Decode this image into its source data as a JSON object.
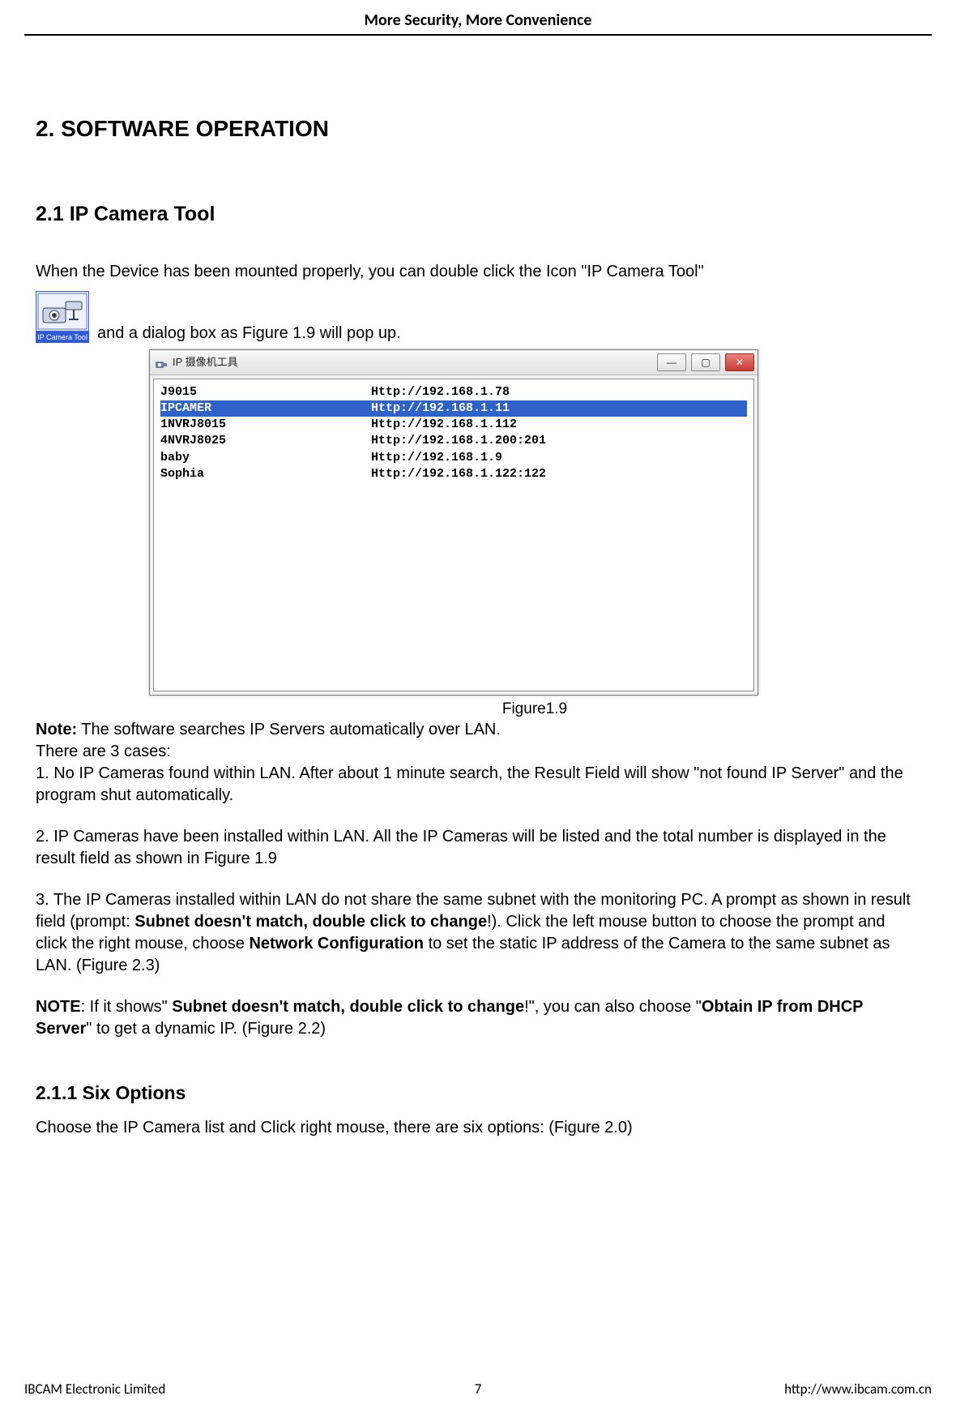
{
  "header": {
    "title": "More Security, More Convenience"
  },
  "section": {
    "h1": "2. SOFTWARE OPERATION",
    "h2": "2.1 IP Camera Tool"
  },
  "intro": {
    "line1": "When the Device has been mounted properly, you can double click the Icon \"IP Camera Tool\"",
    "iconLabel": "IP Camera Tool",
    "line2": " and a dialog box as Figure 1.9 will pop up."
  },
  "window": {
    "title": "IP 摄像机工具",
    "btnMin": "—",
    "btnMax": "▢",
    "btnClose": "✕",
    "rows": [
      {
        "name": "J9015",
        "url": "Http://192.168.1.78",
        "selected": false
      },
      {
        "name": "IPCAMER",
        "url": "Http://192.168.1.11",
        "selected": true
      },
      {
        "name": "1NVRJ8015",
        "url": "Http://192.168.1.112",
        "selected": false
      },
      {
        "name": "4NVRJ8025",
        "url": "Http://192.168.1.200:201",
        "selected": false
      },
      {
        "name": "baby",
        "url": "Http://192.168.1.9",
        "selected": false
      },
      {
        "name": "Sophia",
        "url": "Http://192.168.1.122:122",
        "selected": false
      }
    ]
  },
  "figCaption": "Figure1.9",
  "body": {
    "noteLabel": "Note:",
    "noteText": " The software searches IP Servers automatically over LAN.",
    "casesIntro": "There are 3 cases:",
    "case1": "1. No IP Cameras found within LAN. After about 1 minute search, the Result Field will show \"not found IP Server\" and the program shut automatically.",
    "case2": "2. IP Cameras have been installed within LAN. All the IP Cameras will be listed and the total number is displayed in the result field as shown in Figure 1.9",
    "case3a": "3. The IP Cameras installed within LAN do not share the same subnet with the monitoring PC. A prompt as shown in result field (prompt: ",
    "case3bold1": "Subnet doesn't match, double click to change",
    "case3b": "!). Click the left mouse button to choose the prompt and click the right mouse, choose ",
    "case3bold2": "Network Configuration",
    "case3c": " to set the static IP address of the Camera to the same subnet as LAN. (Figure 2.3)",
    "note2Label": "NOTE",
    "note2a": ": If it shows\" ",
    "note2bold1": "Subnet doesn't match, double click to change",
    "note2b": "!\", you can also choose \"",
    "note2bold2": "Obtain IP from DHCP Server",
    "note2c": "\" to get a dynamic IP. (Figure 2.2)"
  },
  "sixOptions": {
    "heading": "2.1.1 Six Options",
    "text": "Choose the IP Camera list and Click right mouse, there are six options: (Figure 2.0)"
  },
  "footer": {
    "left": "IBCAM Electronic Limited",
    "center": "7",
    "right": "http://www.ibcam.com.cn"
  }
}
